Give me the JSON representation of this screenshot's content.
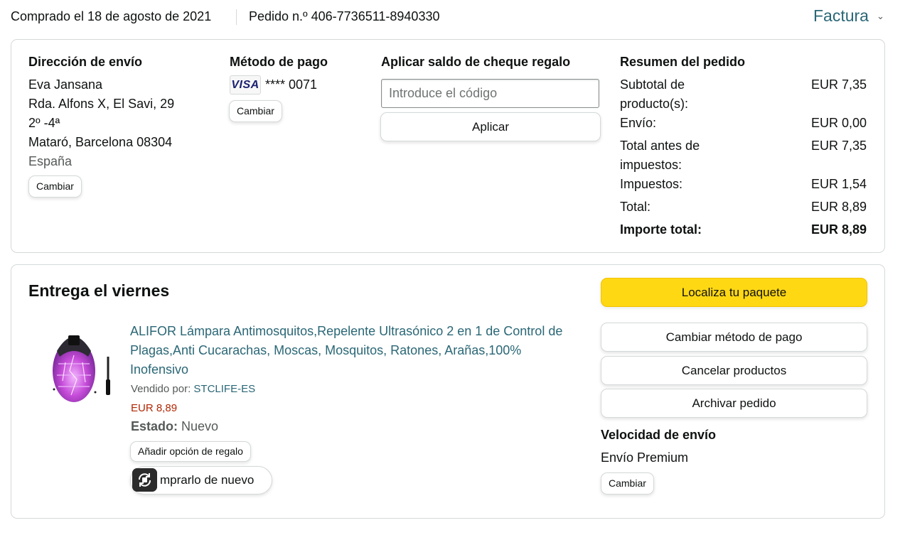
{
  "header": {
    "purchased": "Comprado el 18 de agosto de 2021",
    "order_number": "Pedido n.º 406-7736511-8940330",
    "invoice": "Factura",
    "invoice_chevron": "⌄"
  },
  "shipping_address": {
    "heading": "Dirección de envío",
    "name": "Eva Jansana",
    "line1": "Rda. Alfons X, El Savi, 29",
    "line2": "2º -4ª",
    "city": "Mataró, Barcelona 08304",
    "country": "España",
    "change": "Cambiar"
  },
  "payment": {
    "heading": "Método de pago",
    "card_brand": "VISA",
    "card_number": "**** 0071",
    "change": "Cambiar"
  },
  "gift_card": {
    "heading": "Aplicar saldo de cheque regalo",
    "placeholder": "Introduce el código",
    "apply": "Aplicar"
  },
  "summary": {
    "heading": "Resumen del pedido",
    "rows": [
      {
        "label": "Subtotal de producto(s):",
        "value": "EUR 7,35"
      },
      {
        "label": "Envío:",
        "value": "EUR 0,00"
      },
      {
        "label": "Total antes de impuestos:",
        "value": "EUR 7,35"
      },
      {
        "label": "Impuestos:",
        "value": "EUR 1,54"
      },
      {
        "label": "Total:",
        "value": "EUR 8,89"
      },
      {
        "label": "Importe total:",
        "value": "EUR 8,89"
      }
    ]
  },
  "delivery": {
    "title": "Entrega el viernes",
    "track": "Localiza tu paquete",
    "change_payment": "Cambiar método de pago",
    "cancel": "Cancelar productos",
    "archive": "Archivar pedido",
    "speed_heading": "Velocidad de envío",
    "speed": "Envío Premium",
    "speed_change": "Cambiar"
  },
  "product": {
    "title": "ALIFOR Lámpara Antimosquitos,Repelente Ultrasónico 2 en 1 de Control de Plagas,Anti Cucarachas, Moscas, Mosquitos, Ratones, Arañas,100% Inofensivo",
    "sold_by_label": "Vendido por:",
    "seller": "STCLIFE-ES",
    "price": "EUR 8,89",
    "state_label": "Estado:",
    "state": "Nuevo",
    "gift_option": "Añadir opción de regalo",
    "buy_again": "Comprarlo de nuevo",
    "buy_again_visible": "mprarlo de nuevo"
  },
  "icons": {
    "overlay": "reload-icon",
    "product": "mosquito-lamp-image"
  },
  "colors": {
    "link": "#2a6776",
    "price": "#b12704",
    "primary_button": "#ffd814",
    "border": "#d5d9d9"
  }
}
